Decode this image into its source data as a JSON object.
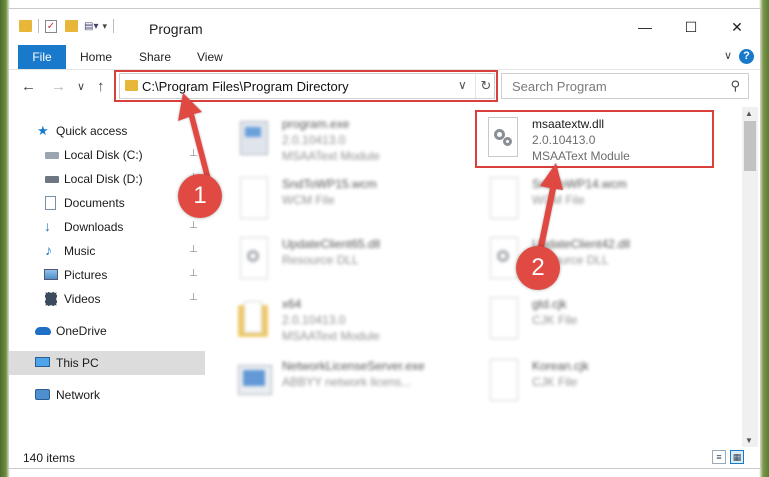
{
  "window": {
    "title": "Program",
    "minimize_glyph": "—",
    "maximize_glyph": "☐",
    "close_glyph": "✕"
  },
  "ribbon": {
    "tabs": [
      {
        "label": "File"
      },
      {
        "label": "Home"
      },
      {
        "label": "Share"
      },
      {
        "label": "View"
      }
    ],
    "collapse_glyph": "∨",
    "help_glyph": "?"
  },
  "nav_buttons": {
    "back": "←",
    "forward": "→",
    "recent": "∨",
    "up": "↑"
  },
  "address": {
    "path": "C:\\Program Files\\Program Directory",
    "dropdown_glyph": "∨",
    "refresh_glyph": "↻"
  },
  "search": {
    "placeholder": "Search Program",
    "icon": "⚲"
  },
  "sidebar": {
    "items": [
      {
        "label": "Quick access",
        "icon": "star-icon",
        "pinned": false,
        "selected": false
      },
      {
        "label": "Local Disk (C:)",
        "icon": "drive-icon",
        "pinned": true,
        "selected": false
      },
      {
        "label": "Local Disk (D:)",
        "icon": "drive-icon",
        "pinned": true,
        "selected": false
      },
      {
        "label": "Documents",
        "icon": "documents-icon",
        "pinned": true,
        "selected": false
      },
      {
        "label": "Downloads",
        "icon": "download-arrow-icon",
        "pinned": true,
        "selected": false
      },
      {
        "label": "Music",
        "icon": "music-note-icon",
        "pinned": true,
        "selected": false
      },
      {
        "label": "Pictures",
        "icon": "pictures-icon",
        "pinned": true,
        "selected": false
      },
      {
        "label": "Videos",
        "icon": "film-icon",
        "pinned": true,
        "selected": false
      },
      {
        "label": "OneDrive",
        "icon": "cloud-icon",
        "pinned": false,
        "selected": false
      },
      {
        "label": "This PC",
        "icon": "monitor-icon",
        "pinned": false,
        "selected": true
      },
      {
        "label": "Network",
        "icon": "network-icon",
        "pinned": false,
        "selected": false
      }
    ],
    "pin_glyph": "📌"
  },
  "files": [
    {
      "name": "program.exe",
      "line1": "2.0.10413.0",
      "line2": "MSAAText Module",
      "icon": "exe-icon",
      "blurred": true
    },
    {
      "name": "msaatextw.dll",
      "line1": "2.0.10413.0",
      "line2": "MSAAText Module",
      "icon": "dll-gear-icon",
      "blurred": false
    },
    {
      "name": "SndToWP15.wcm",
      "line1": "WCM File",
      "line2": "",
      "icon": "document-icon",
      "blurred": true
    },
    {
      "name": "SndToWP14.wcm",
      "line1": "WCM File",
      "line2": "",
      "icon": "document-icon",
      "blurred": true
    },
    {
      "name": "UpdateClient65.dll",
      "line1": "Resource DLL",
      "line2": "",
      "icon": "dll-gear-icon",
      "blurred": true
    },
    {
      "name": "UpdateClient42.dll",
      "line1": "Resource DLL",
      "line2": "",
      "icon": "dll-gear-icon",
      "blurred": true
    },
    {
      "name": "x64",
      "line1": "2.0.10413.0",
      "line2": "MSAAText Module",
      "icon": "folder-icon",
      "blurred": true
    },
    {
      "name": "gtd.cjk",
      "line1": "CJK File",
      "line2": "",
      "icon": "document-icon",
      "blurred": true
    },
    {
      "name": "NetworkLicenseServer.exe",
      "line1": "ABBYY network licens...",
      "line2": "",
      "icon": "exe-icon",
      "blurred": true
    },
    {
      "name": "Korean.cjk",
      "line1": "CJK File",
      "line2": "",
      "icon": "document-icon",
      "blurred": true
    }
  ],
  "status": {
    "item_count": "140 items"
  },
  "annotations": [
    {
      "label": "1"
    },
    {
      "label": "2"
    }
  ],
  "colors": {
    "accent": "#1979ca",
    "annotation_red": "#d9403c",
    "folder": "#e8b73a"
  }
}
